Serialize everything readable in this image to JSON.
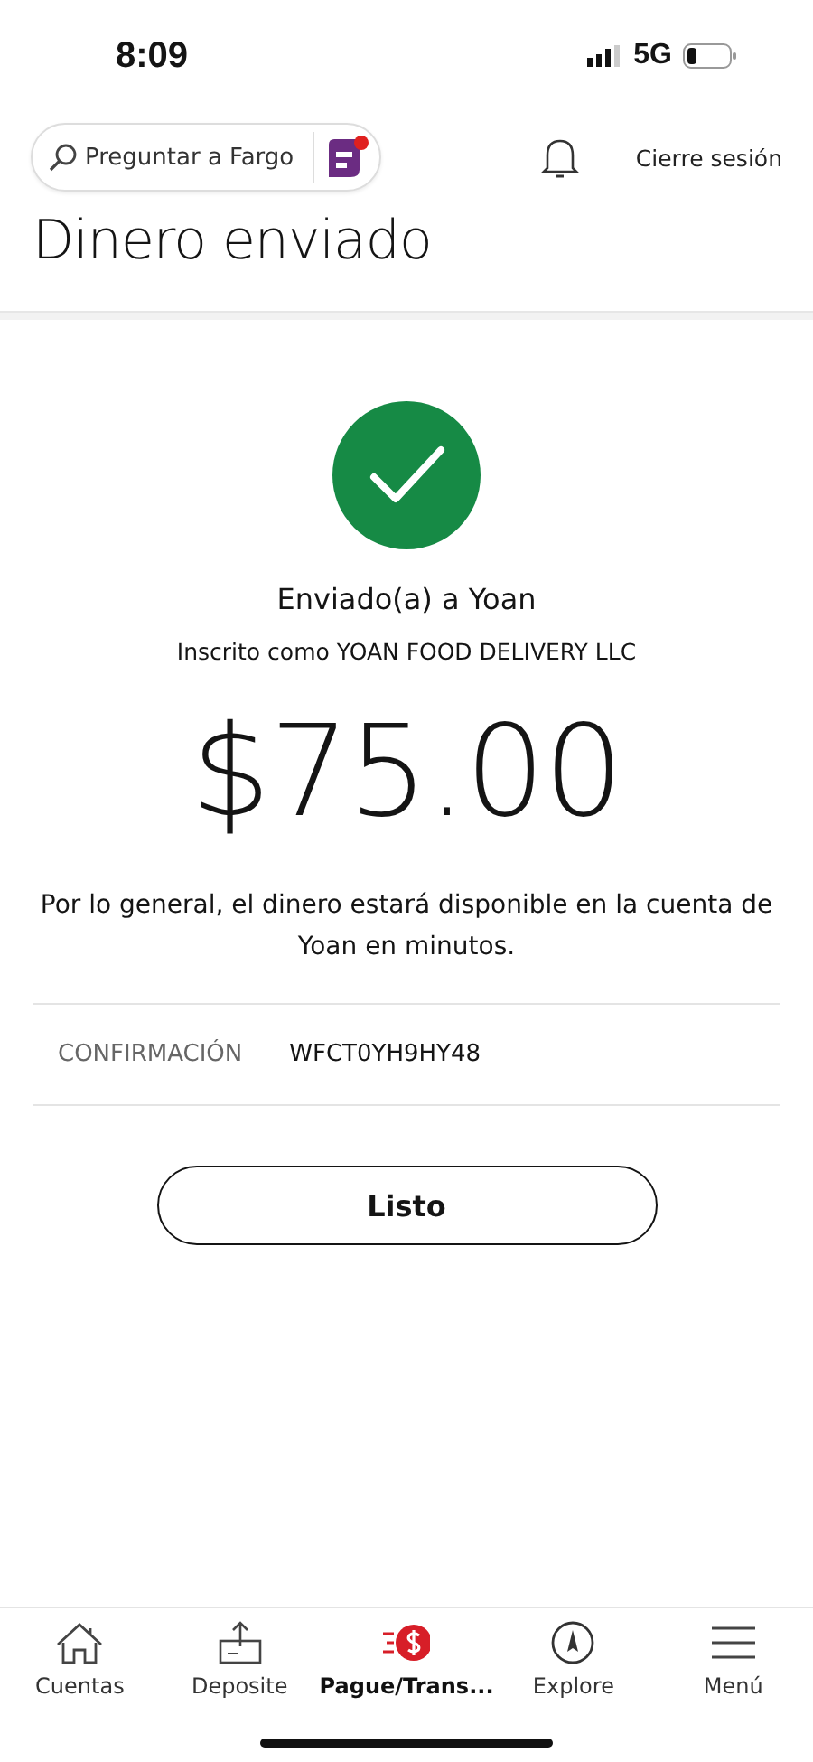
{
  "status_bar": {
    "time": "8:09",
    "network": "5G"
  },
  "header": {
    "search": {
      "placeholder": "Preguntar a Fargo",
      "notification": true
    },
    "logout": "Cierre sesión"
  },
  "title": "Dinero enviado",
  "confirmation": {
    "recipient": "Enviado(a) a Yoan",
    "enrolled_as": "Inscrito como YOAN FOOD DELIVERY LLC",
    "amount": "$75.00",
    "note": "Por lo general, el dinero estará disponible en la cuenta de Yoan en minutos.",
    "details": [
      {
        "label": "CONFIRMACIÓN",
        "value": "WFCT0YH9HY48"
      }
    ],
    "button": "Listo"
  },
  "tab_bar": [
    {
      "kind": "home",
      "label": "Cuentas",
      "selected": false
    },
    {
      "kind": "deposit",
      "label": "Deposite",
      "selected": false
    },
    {
      "kind": "pay",
      "label": "Pague/Trans...",
      "selected": true
    },
    {
      "kind": "explore",
      "label": "Explore",
      "selected": false
    },
    {
      "kind": "menu",
      "label": "Menú",
      "selected": false
    }
  ]
}
